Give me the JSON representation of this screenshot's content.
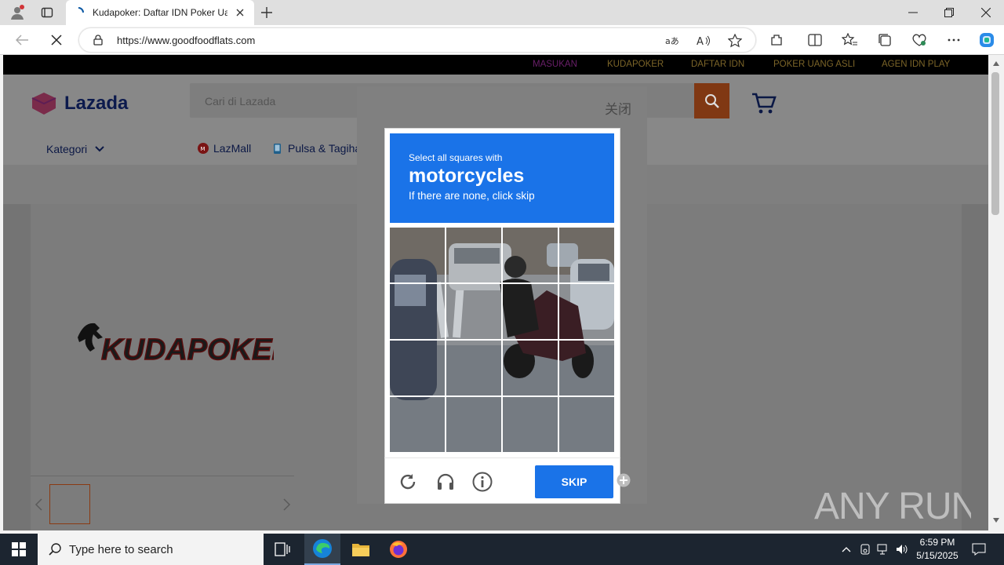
{
  "browser": {
    "tab_title": "Kudapoker: Daftar IDN Poker Uang",
    "url": "https://www.goodfoodflats.com",
    "icons": [
      "profile-icon",
      "tab-actions-icon",
      "new-tab-icon",
      "back-icon",
      "stop-icon",
      "site-info-icon",
      "translate-icon",
      "read-aloud-icon",
      "favorite-star-icon",
      "extensions-icon",
      "split-screen-icon",
      "favorites-icon",
      "collections-icon",
      "browser-essentials-icon",
      "more-icon",
      "copilot-icon",
      "minimize-icon",
      "restore-icon",
      "close-icon"
    ]
  },
  "site": {
    "topnav": [
      "MASUKAN",
      "KUDAPOKER",
      "DAFTAR IDN",
      "POKER UANG ASLI",
      "AGEN IDN PLAY"
    ],
    "logo": "Lazada",
    "search_placeholder": "Cari di Lazada",
    "category_label": "Kategori",
    "lazmall_label": "LazMall",
    "pulsa_label": "Pulsa & Tagiha",
    "banner_logo_text": "KUDAPOKER"
  },
  "modal": {
    "close_label": "关闭"
  },
  "captcha": {
    "instruction": "Select all squares with",
    "target": "motorcycles",
    "hint": "If there are none, click skip",
    "skip_label": "SKIP",
    "grid_rows": 4,
    "grid_cols": 4
  },
  "taskbar": {
    "search_placeholder": "Type here to search",
    "time": "6:59 PM",
    "date": "5/15/2025"
  },
  "watermark": "ANY RUN",
  "colors": {
    "captcha_blue": "#1a73e8",
    "topnav_text": "#7b6428",
    "taskbar": "#1c2530"
  }
}
